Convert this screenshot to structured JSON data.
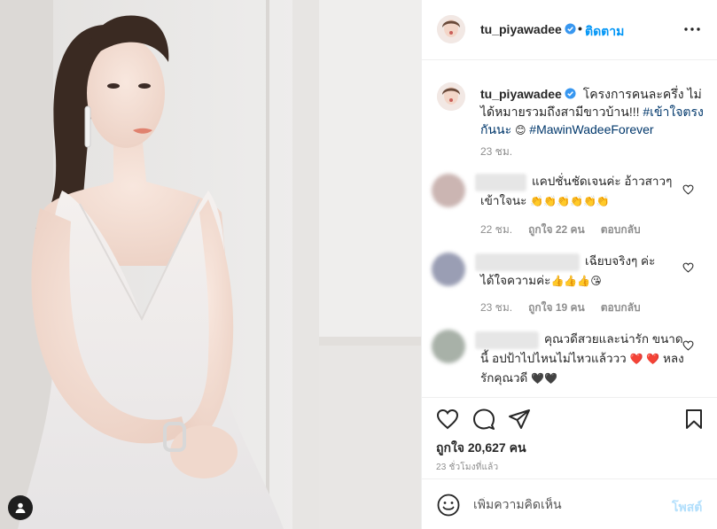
{
  "post": {
    "author": "tu_piyawadee",
    "follow_label": "ติดตาม",
    "header_dot": "•",
    "caption_text": "โครงการคนละครึ่ง ไม่ได้หมายรวมถึงสามีขาวบ้าน!!! ",
    "caption_hashtag1": "#เข้าใจตรงกันนะ",
    "caption_emoji": " 😊 ",
    "caption_hashtag2": "#MawinWadeeForever",
    "caption_time": "23 ชม."
  },
  "comments": [
    {
      "text": "แคปชั่นชัดเจนค่ะ อ้าวสาวๆ เข้าใจนะ",
      "emoji": "👏👏👏👏👏👏",
      "time": "22 ชม.",
      "likes": "ถูกใจ 22 คน",
      "reply": "ตอบกลับ"
    },
    {
      "text": "เฉียบจริงๆ ค่ะ ได้ใจความค่ะ",
      "emoji": "👍👍👍😘",
      "time": "23 ชม.",
      "likes": "ถูกใจ 19 คน",
      "reply": "ตอบกลับ"
    },
    {
      "text": "คุณวดีสวยและน่ารัก ขนาดนี้ อปป้าไปไหนไม่ไหวแล้ววว",
      "emoji_start": "❤️ ❤️",
      "text2": " หลงรักคุณวดี ",
      "emoji_end": "🖤🖤"
    }
  ],
  "actions": {
    "likes": "ถูกใจ 20,627 คน",
    "time_ago": "23 ชั่วโมงที่แล้ว"
  },
  "add_comment": {
    "placeholder": "เพิ่มความคิดเห็น",
    "post_label": "โพสต์"
  },
  "icons": {
    "verified": "verified-badge-icon",
    "more": "more-options-icon",
    "heart": "heart-icon",
    "comment": "comment-icon",
    "share": "share-icon",
    "save": "bookmark-icon",
    "emoji": "emoji-icon",
    "tag": "user-tag-icon"
  },
  "colors": {
    "accent": "#0095f6",
    "hashtag": "#00376b",
    "muted": "#8e8e8e",
    "post_disabled": "#b2dffc"
  }
}
